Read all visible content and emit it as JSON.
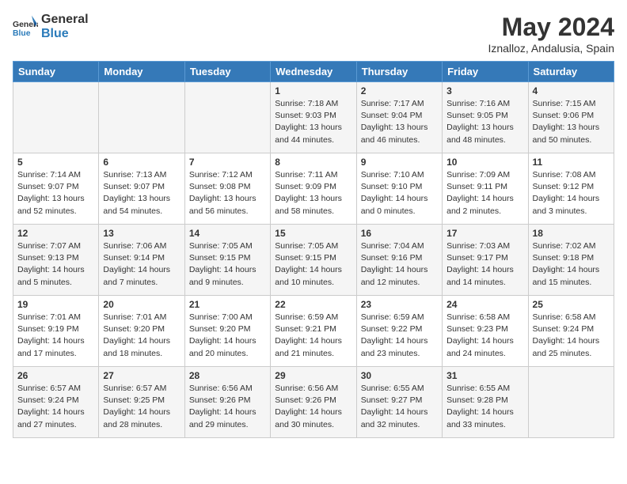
{
  "header": {
    "logo_general": "General",
    "logo_blue": "Blue",
    "month_year": "May 2024",
    "location": "Iznalloz, Andalusia, Spain"
  },
  "weekdays": [
    "Sunday",
    "Monday",
    "Tuesday",
    "Wednesday",
    "Thursday",
    "Friday",
    "Saturday"
  ],
  "weeks": [
    [
      {
        "day": "",
        "info": ""
      },
      {
        "day": "",
        "info": ""
      },
      {
        "day": "",
        "info": ""
      },
      {
        "day": "1",
        "info": "Sunrise: 7:18 AM\nSunset: 9:03 PM\nDaylight: 13 hours\nand 44 minutes."
      },
      {
        "day": "2",
        "info": "Sunrise: 7:17 AM\nSunset: 9:04 PM\nDaylight: 13 hours\nand 46 minutes."
      },
      {
        "day": "3",
        "info": "Sunrise: 7:16 AM\nSunset: 9:05 PM\nDaylight: 13 hours\nand 48 minutes."
      },
      {
        "day": "4",
        "info": "Sunrise: 7:15 AM\nSunset: 9:06 PM\nDaylight: 13 hours\nand 50 minutes."
      }
    ],
    [
      {
        "day": "5",
        "info": "Sunrise: 7:14 AM\nSunset: 9:07 PM\nDaylight: 13 hours\nand 52 minutes."
      },
      {
        "day": "6",
        "info": "Sunrise: 7:13 AM\nSunset: 9:07 PM\nDaylight: 13 hours\nand 54 minutes."
      },
      {
        "day": "7",
        "info": "Sunrise: 7:12 AM\nSunset: 9:08 PM\nDaylight: 13 hours\nand 56 minutes."
      },
      {
        "day": "8",
        "info": "Sunrise: 7:11 AM\nSunset: 9:09 PM\nDaylight: 13 hours\nand 58 minutes."
      },
      {
        "day": "9",
        "info": "Sunrise: 7:10 AM\nSunset: 9:10 PM\nDaylight: 14 hours\nand 0 minutes."
      },
      {
        "day": "10",
        "info": "Sunrise: 7:09 AM\nSunset: 9:11 PM\nDaylight: 14 hours\nand 2 minutes."
      },
      {
        "day": "11",
        "info": "Sunrise: 7:08 AM\nSunset: 9:12 PM\nDaylight: 14 hours\nand 3 minutes."
      }
    ],
    [
      {
        "day": "12",
        "info": "Sunrise: 7:07 AM\nSunset: 9:13 PM\nDaylight: 14 hours\nand 5 minutes."
      },
      {
        "day": "13",
        "info": "Sunrise: 7:06 AM\nSunset: 9:14 PM\nDaylight: 14 hours\nand 7 minutes."
      },
      {
        "day": "14",
        "info": "Sunrise: 7:05 AM\nSunset: 9:15 PM\nDaylight: 14 hours\nand 9 minutes."
      },
      {
        "day": "15",
        "info": "Sunrise: 7:05 AM\nSunset: 9:15 PM\nDaylight: 14 hours\nand 10 minutes."
      },
      {
        "day": "16",
        "info": "Sunrise: 7:04 AM\nSunset: 9:16 PM\nDaylight: 14 hours\nand 12 minutes."
      },
      {
        "day": "17",
        "info": "Sunrise: 7:03 AM\nSunset: 9:17 PM\nDaylight: 14 hours\nand 14 minutes."
      },
      {
        "day": "18",
        "info": "Sunrise: 7:02 AM\nSunset: 9:18 PM\nDaylight: 14 hours\nand 15 minutes."
      }
    ],
    [
      {
        "day": "19",
        "info": "Sunrise: 7:01 AM\nSunset: 9:19 PM\nDaylight: 14 hours\nand 17 minutes."
      },
      {
        "day": "20",
        "info": "Sunrise: 7:01 AM\nSunset: 9:20 PM\nDaylight: 14 hours\nand 18 minutes."
      },
      {
        "day": "21",
        "info": "Sunrise: 7:00 AM\nSunset: 9:20 PM\nDaylight: 14 hours\nand 20 minutes."
      },
      {
        "day": "22",
        "info": "Sunrise: 6:59 AM\nSunset: 9:21 PM\nDaylight: 14 hours\nand 21 minutes."
      },
      {
        "day": "23",
        "info": "Sunrise: 6:59 AM\nSunset: 9:22 PM\nDaylight: 14 hours\nand 23 minutes."
      },
      {
        "day": "24",
        "info": "Sunrise: 6:58 AM\nSunset: 9:23 PM\nDaylight: 14 hours\nand 24 minutes."
      },
      {
        "day": "25",
        "info": "Sunrise: 6:58 AM\nSunset: 9:24 PM\nDaylight: 14 hours\nand 25 minutes."
      }
    ],
    [
      {
        "day": "26",
        "info": "Sunrise: 6:57 AM\nSunset: 9:24 PM\nDaylight: 14 hours\nand 27 minutes."
      },
      {
        "day": "27",
        "info": "Sunrise: 6:57 AM\nSunset: 9:25 PM\nDaylight: 14 hours\nand 28 minutes."
      },
      {
        "day": "28",
        "info": "Sunrise: 6:56 AM\nSunset: 9:26 PM\nDaylight: 14 hours\nand 29 minutes."
      },
      {
        "day": "29",
        "info": "Sunrise: 6:56 AM\nSunset: 9:26 PM\nDaylight: 14 hours\nand 30 minutes."
      },
      {
        "day": "30",
        "info": "Sunrise: 6:55 AM\nSunset: 9:27 PM\nDaylight: 14 hours\nand 32 minutes."
      },
      {
        "day": "31",
        "info": "Sunrise: 6:55 AM\nSunset: 9:28 PM\nDaylight: 14 hours\nand 33 minutes."
      },
      {
        "day": "",
        "info": ""
      }
    ]
  ]
}
